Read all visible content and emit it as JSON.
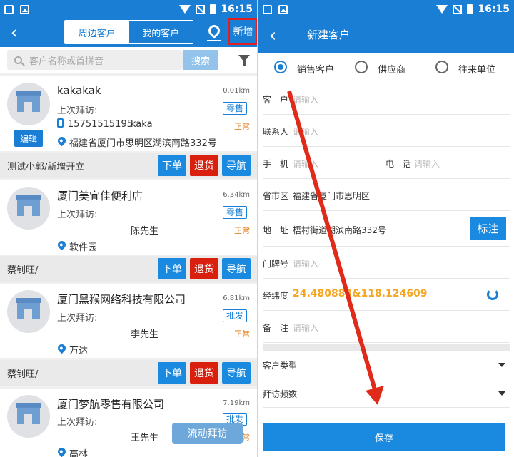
{
  "status_bar": {
    "time": "16:15"
  },
  "left": {
    "tabs": {
      "nearby": "周边客户",
      "mine": "我的客户"
    },
    "new_label": "新增",
    "search": {
      "placeholder": "客户名称或首拼音",
      "button": "搜索"
    },
    "customers": [
      {
        "name": "kakakak",
        "distance": "0.01km",
        "last_visit": "上次拜访:",
        "type": "零售",
        "status": "正常",
        "phone": "15751515195",
        "contact": "kaka",
        "address": "福建省厦门市思明区湖滨南路332号",
        "edit": "编辑",
        "creator": "测试小郭/新增开立"
      },
      {
        "name": "厦门美宜佳便利店",
        "distance": "6.34km",
        "last_visit": "上次拜访:",
        "type": "零售",
        "status": "正常",
        "contact": "陈先生",
        "address": "软件园",
        "creator": "蔡钊旺/"
      },
      {
        "name": "厦门黑猴网络科技有限公司",
        "distance": "6.81km",
        "last_visit": "上次拜访:",
        "type": "批发",
        "status": "正常",
        "contact": "李先生",
        "address": "万达",
        "creator": "蔡钊旺/"
      },
      {
        "name": "厦门梦航零售有限公司",
        "distance": "7.19km",
        "last_visit": "上次拜访:",
        "type": "批发",
        "status": "常",
        "contact": "王先生",
        "address": "高林"
      }
    ],
    "actions": {
      "order": "下单",
      "return": "退货",
      "navigate": "导航"
    },
    "flow_visit": "流动拜访"
  },
  "right": {
    "title": "新建客户",
    "types": [
      "销售客户",
      "供应商",
      "往来单位"
    ],
    "fields": {
      "customer_label": "客　户",
      "customer_ph": "请输入",
      "contact_label": "联系人",
      "contact_ph": "请输入",
      "mobile_label": "手　机",
      "mobile_ph": "请输入",
      "tel_label": "电　话",
      "tel_ph": "请输入",
      "region_label": "省市区",
      "region_val": "福建省厦门市思明区",
      "address_label": "地　址",
      "address_val": "梧村街道湖滨南路332号",
      "mark": "标注",
      "door_label": "门牌号",
      "door_ph": "请输入",
      "coord_label": "经纬度",
      "coord_val": "24.480883&118.124609",
      "note_label": "备　注",
      "note_ph": "请输入"
    },
    "customer_type": "客户类型",
    "visit_freq": "拜访频数",
    "save": "保存"
  },
  "colors": {
    "primary": "#1a7fd4",
    "danger": "#d9200f",
    "warning": "#e07000",
    "highlight": "#e02020"
  }
}
